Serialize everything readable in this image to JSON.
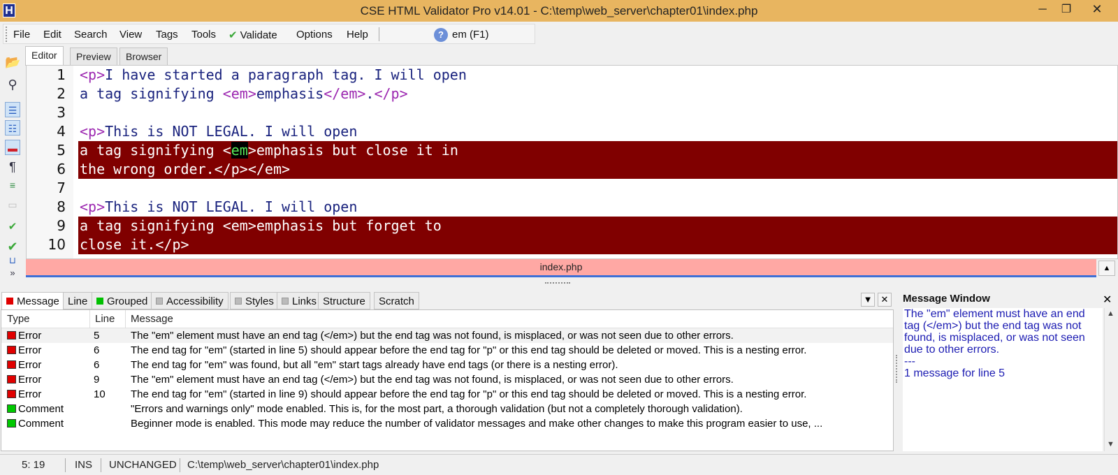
{
  "window": {
    "app_icon_letter": "H",
    "title": "CSE HTML Validator Pro v14.01 - C:\\temp\\web_server\\chapter01\\index.php",
    "minimize_glyph": "─",
    "maximize_glyph": "❐",
    "close_glyph": "✕"
  },
  "menu": {
    "items": [
      "File",
      "Edit",
      "Search",
      "View",
      "Tags",
      "Tools",
      "Validate",
      "Options",
      "Help"
    ],
    "validate_icon": "check-icon",
    "help_icon_glyph": "?",
    "help_label": "em (F1)"
  },
  "editor_tabs": [
    "Editor",
    "Preview",
    "Browser"
  ],
  "editor": {
    "lines": [
      {
        "num": "1",
        "parts": [
          [
            "tag",
            "<p>"
          ],
          [
            "text",
            "I have started a paragraph tag. I will open"
          ]
        ],
        "error": false
      },
      {
        "num": "2",
        "parts": [
          [
            "text",
            "a tag signifying "
          ],
          [
            "tag",
            "<em>"
          ],
          [
            "text",
            "emphasis"
          ],
          [
            "tag",
            "</em>"
          ],
          [
            "text",
            "."
          ],
          [
            "tag",
            "</p>"
          ]
        ],
        "error": false
      },
      {
        "num": "3",
        "parts": [],
        "error": false
      },
      {
        "num": "4",
        "parts": [
          [
            "tag",
            "<p>"
          ],
          [
            "text",
            "This is NOT LEGAL. I will open"
          ]
        ],
        "error": false
      },
      {
        "num": "5",
        "parts": [
          [
            "text",
            "a tag signifying <"
          ],
          [
            "cursor",
            "em"
          ],
          [
            "text",
            ">emphasis but close it in"
          ]
        ],
        "error": true
      },
      {
        "num": "6",
        "parts": [
          [
            "text",
            "the wrong order.</p></em>"
          ]
        ],
        "error": true
      },
      {
        "num": "7",
        "parts": [],
        "error": false
      },
      {
        "num": "8",
        "parts": [
          [
            "tag",
            "<p>"
          ],
          [
            "text",
            "This is NOT LEGAL. I will open"
          ]
        ],
        "error": false
      },
      {
        "num": "9",
        "parts": [
          [
            "text",
            "a tag signifying <em>emphasis but forget to"
          ]
        ],
        "error": true
      },
      {
        "num": "10",
        "parts": [
          [
            "text",
            "close it.</p>"
          ]
        ],
        "error": true
      }
    ],
    "colors": {
      "text": "#1a237e",
      "tag": "#9c27b0",
      "error_bg": "#800000",
      "cursor_fg": "#59e859"
    }
  },
  "file_tab": "index.php",
  "bottom_tabs": [
    {
      "label": "Message",
      "marker": "red"
    },
    {
      "label": "Line",
      "marker": "none"
    },
    {
      "label": "Grouped",
      "marker": "green"
    },
    {
      "label": "Accessibility",
      "marker": "gray"
    },
    {
      "label": "Styles",
      "marker": "gray"
    },
    {
      "label": "Links",
      "marker": "gray"
    },
    {
      "label": "Structure",
      "marker": "none"
    },
    {
      "label": "Scratch",
      "marker": "none"
    }
  ],
  "messages": {
    "columns": [
      "Type",
      "Line",
      "Message"
    ],
    "rows": [
      {
        "type": "Error",
        "line": "5",
        "message": "The \"em\" element must have an end tag (</em>) but the end tag was not found, is misplaced, or was not seen due to other errors.",
        "level": "red"
      },
      {
        "type": "Error",
        "line": "6",
        "message": "The end tag for \"em\" (started in line 5) should appear before the end tag for \"p\" or this end tag should be deleted or moved. This is a nesting error.",
        "level": "red"
      },
      {
        "type": "Error",
        "line": "6",
        "message": "The end tag for \"em\" was found, but all \"em\" start tags already have end tags (or there is a nesting error).",
        "level": "red"
      },
      {
        "type": "Error",
        "line": "9",
        "message": "The \"em\" element must have an end tag (</em>) but the end tag was not found, is misplaced, or was not seen due to other errors.",
        "level": "red"
      },
      {
        "type": "Error",
        "line": "10",
        "message": "The end tag for \"em\" (started in line 9) should appear before the end tag for \"p\" or this end tag should be deleted or moved. This is a nesting error.",
        "level": "red"
      },
      {
        "type": "Comment",
        "line": "",
        "message": "\"Errors and warnings only\" mode enabled. This is, for the most part, a thorough validation (but not a completely thorough validation).",
        "level": "green"
      },
      {
        "type": "Comment",
        "line": "",
        "message": "Beginner mode is enabled. This mode may reduce the number of validator messages and make other changes to make this program easier to use, ...",
        "level": "green"
      }
    ]
  },
  "message_window": {
    "title": "Message Window",
    "close_glyph": "✕",
    "text": "The \"em\" element must have an end tag (</em>) but the end tag was not found, is misplaced, or was not seen due to other errors.",
    "separator": "---",
    "footer": "1 message for line 5"
  },
  "status": {
    "position": "5: 19",
    "mode": "INS",
    "state": "UNCHANGED",
    "path": "C:\\temp\\web_server\\chapter01\\index.php"
  }
}
